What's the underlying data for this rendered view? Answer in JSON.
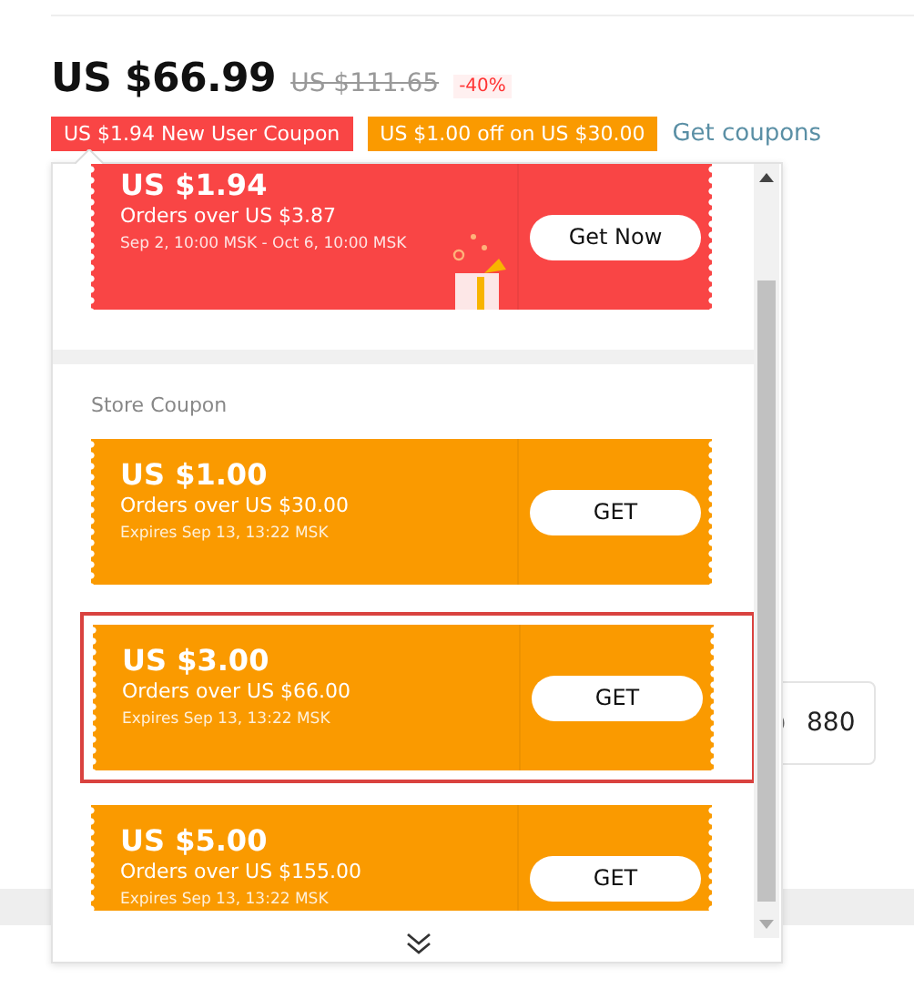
{
  "price": {
    "current": "US $66.99",
    "original": "US $111.65",
    "discount": "-40%"
  },
  "tags": [
    {
      "kind": "new_user",
      "label": "US $1.94 New User Coupon"
    },
    {
      "kind": "store",
      "label": "US $1.00 off on US $30.00"
    }
  ],
  "get_coupons_link": "Get coupons",
  "popup": {
    "coupons_top": [
      {
        "kind": "new_user",
        "amount": "US $1.94",
        "condition": "Orders over US $3.87",
        "validity": "Sep 2, 10:00 MSK - Oct 6, 10:00 MSK",
        "button": "Get Now",
        "selected": false
      }
    ],
    "section_title": "Store Coupon",
    "coupons": [
      {
        "kind": "store",
        "amount": "US $1.00",
        "condition": "Orders over US $30.00",
        "validity": "Expires Sep 13, 13:22 MSK",
        "button": "GET",
        "selected": false
      },
      {
        "kind": "store",
        "amount": "US $3.00",
        "condition": "Orders over US $66.00",
        "validity": "Expires Sep 13, 13:22 MSK",
        "button": "GET",
        "selected": true
      },
      {
        "kind": "store",
        "amount": "US $5.00",
        "condition": "Orders over US $155.00",
        "validity": "Expires Sep 13, 13:22 MSK",
        "button": "GET",
        "selected": false
      }
    ]
  },
  "background_field": {
    "value": "880"
  }
}
